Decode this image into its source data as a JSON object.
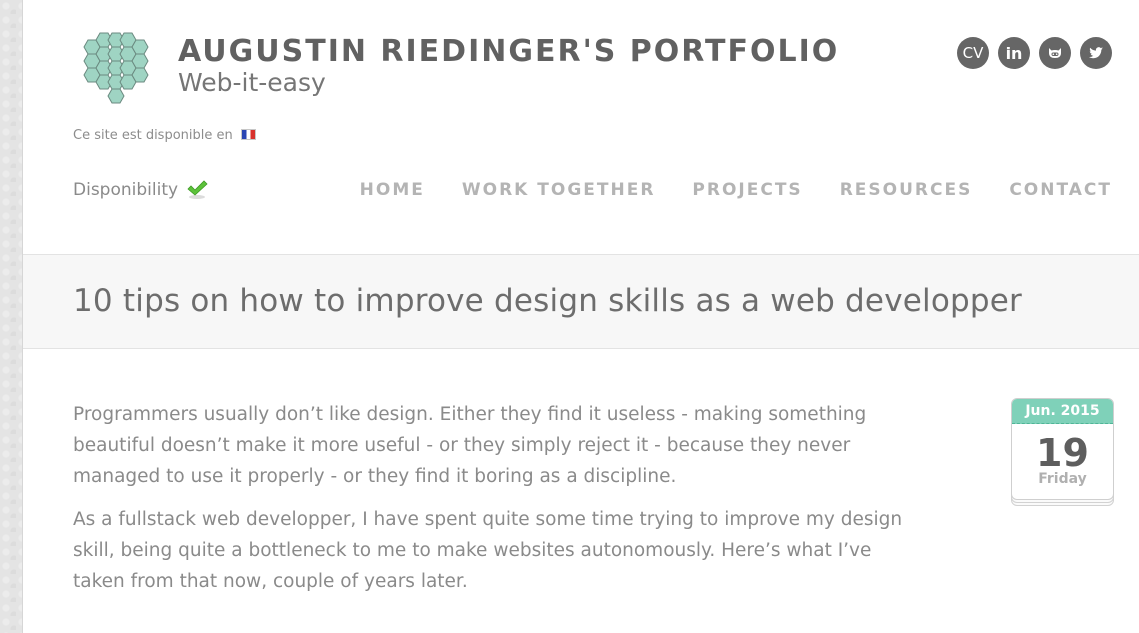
{
  "header": {
    "title": "AUGUSTIN RIEDINGER'S PORTFOLIO",
    "subtitle": "Web-it-easy",
    "lang_note": "Ce site est disponible en",
    "lang_flag": "french-flag",
    "availability_label": "Disponibility",
    "availability_icon": "check-icon",
    "availability_color": "#5cc23a"
  },
  "socials": [
    {
      "label": "CV",
      "icon": "cv-icon"
    },
    {
      "label": "in",
      "icon": "linkedin-icon"
    },
    {
      "label": "",
      "icon": "github-icon"
    },
    {
      "label": "",
      "icon": "twitter-icon"
    }
  ],
  "nav": [
    {
      "label": "HOME"
    },
    {
      "label": "WORK TOGETHER"
    },
    {
      "label": "PROJECTS"
    },
    {
      "label": "RESOURCES"
    },
    {
      "label": "CONTACT"
    }
  ],
  "post": {
    "title": "10 tips on how to improve design skills as a web developper",
    "paragraphs": [
      "Programmers usually don’t like design. Either they find it useless - making something beautiful doesn’t make it more useful - or they simply reject it - because they never managed to use it properly - or they find it boring as a discipline.",
      "As a fullstack web developper, I have spent quite some time trying to improve my design skill, being quite a bottleneck to me to make websites autonomously. Here’s what I’ve taken from that now, couple of years later."
    ],
    "date": {
      "month_year": "Jun. 2015",
      "day": "19",
      "weekday": "Friday"
    }
  },
  "colors": {
    "accent": "#7fd1b9",
    "text": "#8a8a8a",
    "title": "#616161",
    "nav": "#b4b4b4",
    "social_bg": "#666666"
  }
}
